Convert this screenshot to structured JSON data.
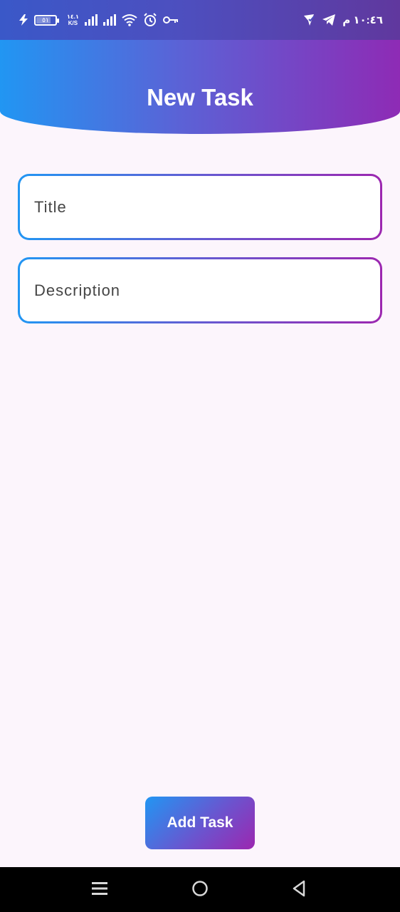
{
  "status_bar": {
    "net_speed_value": "١٤.١",
    "net_speed_unit": "K/S",
    "battery_level": "٥١",
    "time": "١٠:٤٦ م"
  },
  "header": {
    "title": "New Task"
  },
  "form": {
    "title_placeholder": "Title",
    "title_value": "",
    "description_placeholder": "Description",
    "description_value": ""
  },
  "actions": {
    "add_task_label": "Add Task"
  },
  "colors": {
    "gradient_start": "#2196f3",
    "gradient_end": "#9c27b0",
    "background": "#fcf5fc"
  },
  "icons": {
    "status_left": [
      "charging-icon",
      "battery-icon",
      "network-speed",
      "signal-icon",
      "signal-icon",
      "wifi-icon",
      "alarm-icon",
      "vpn-key-icon"
    ],
    "status_right": [
      "location-check-icon",
      "telegram-icon"
    ],
    "nav": [
      "recents-icon",
      "home-icon",
      "back-icon"
    ]
  }
}
